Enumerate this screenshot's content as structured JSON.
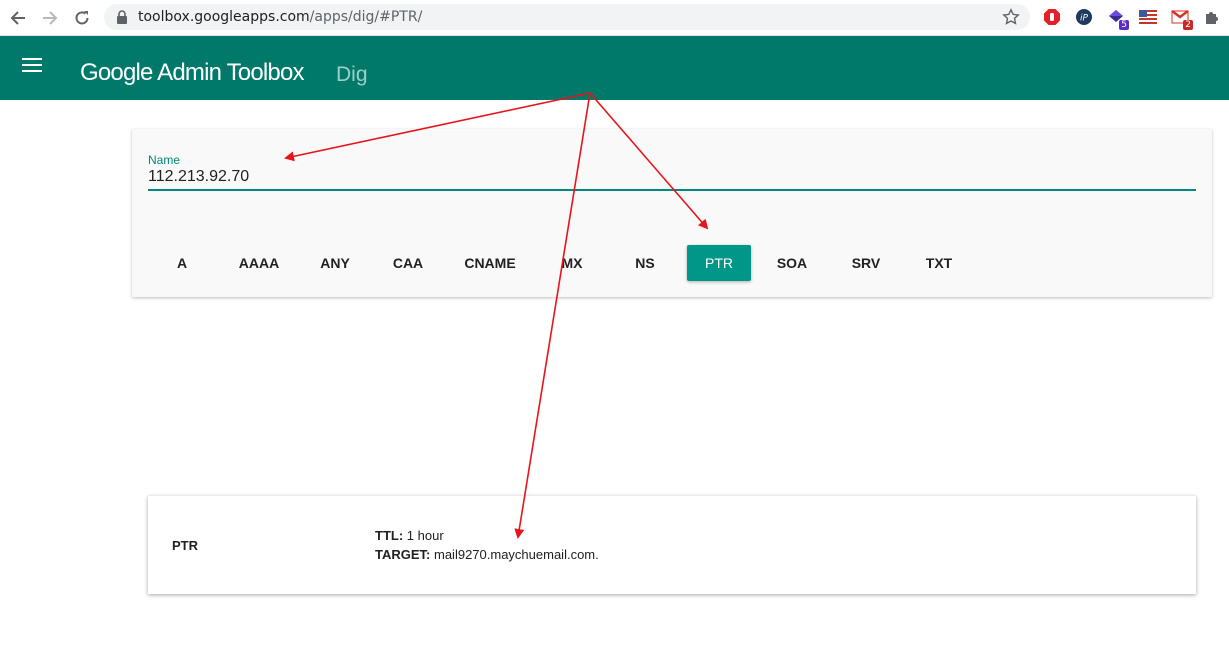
{
  "browser": {
    "url_host": "toolbox.googleapps.com",
    "url_path": "/apps/dig/#PTR/",
    "extensions": [
      {
        "name": "adblock-icon",
        "color": "#e4202b"
      },
      {
        "name": "ip-icon",
        "color": "#1f3a5f",
        "label": "iP"
      },
      {
        "name": "diamond-icon",
        "color": "#5b2fbf",
        "badge": "5"
      },
      {
        "name": "flag-icon",
        "color": "#3c5a9a"
      },
      {
        "name": "gmail-icon",
        "color": "#d93025",
        "badge": "2"
      },
      {
        "name": "puzzle-icon",
        "color": "#5f6368"
      }
    ]
  },
  "header": {
    "title": "Google Admin Toolbox",
    "subtitle": "Dig",
    "color": "#00796b"
  },
  "query": {
    "name_label": "Name",
    "name_value": "112.213.92.70",
    "record_types": [
      "A",
      "AAAA",
      "ANY",
      "CAA",
      "CNAME",
      "MX",
      "NS",
      "PTR",
      "SOA",
      "SRV",
      "TXT"
    ],
    "selected_type": "PTR",
    "accent": "#009688"
  },
  "result": {
    "type": "PTR",
    "ttl_label": "TTL:",
    "ttl_value": "1 hour",
    "target_label": "TARGET:",
    "target_value": "mail9270.maychuemail.com."
  },
  "annotation": {
    "arrow_color": "#e8141b"
  }
}
